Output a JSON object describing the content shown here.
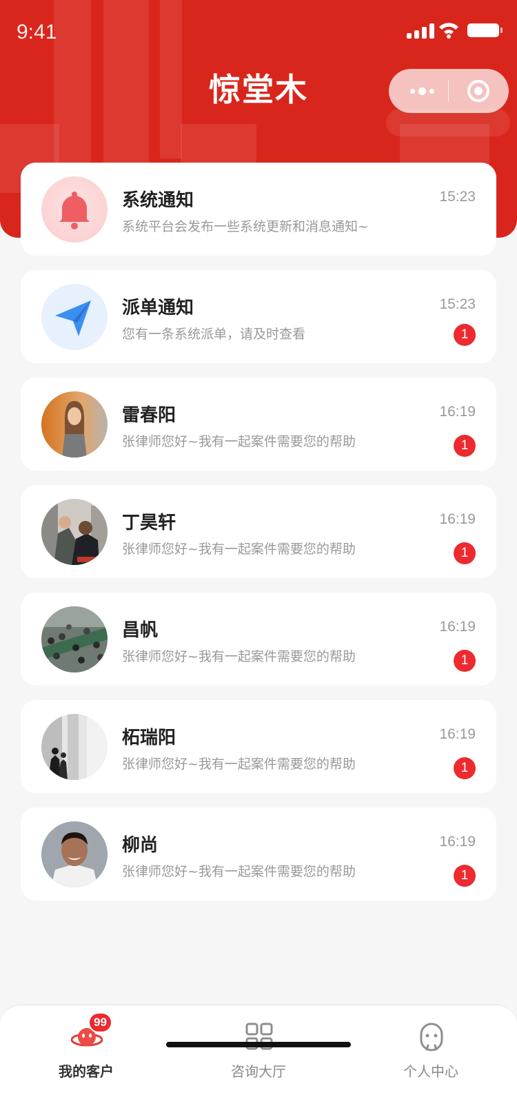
{
  "status_bar": {
    "time": "9:41"
  },
  "header": {
    "app_title": "惊堂木"
  },
  "messages": [
    {
      "title": "系统通知",
      "preview": "系统平台会发布一些系统更新和消息通知~",
      "time": "15:23",
      "avatar": "bell-icon"
    },
    {
      "title": "派单通知",
      "preview": "您有一条系统派单，请及时查看",
      "time": "15:23",
      "badge": "1",
      "avatar": "paper-plane-icon"
    },
    {
      "title": "雷春阳",
      "preview": "张律师您好~我有一起案件需要您的帮助",
      "time": "16:19",
      "badge": "1",
      "avatar": "user-photo"
    },
    {
      "title": "丁昊轩",
      "preview": "张律师您好~我有一起案件需要您的帮助",
      "time": "16:19",
      "badge": "1",
      "avatar": "user-photo"
    },
    {
      "title": "昌帆",
      "preview": "张律师您好~我有一起案件需要您的帮助",
      "time": "16:19",
      "badge": "1",
      "avatar": "user-photo"
    },
    {
      "title": "柘瑞阳",
      "preview": "张律师您好~我有一起案件需要您的帮助",
      "time": "16:19",
      "badge": "1",
      "avatar": "user-photo"
    },
    {
      "title": "柳尚",
      "preview": "张律师您好~我有一起案件需要您的帮助",
      "time": "16:19",
      "badge": "1",
      "avatar": "user-photo"
    }
  ],
  "tab_bar": {
    "tabs": [
      {
        "label": "我的客户",
        "icon": "customers-icon",
        "badge": "99",
        "active": true
      },
      {
        "label": "咨询大厅",
        "icon": "grid-icon",
        "active": false
      },
      {
        "label": "个人中心",
        "icon": "user-face-icon",
        "active": false
      }
    ]
  },
  "colors": {
    "brand_red": "#d9261c",
    "badge_red": "#ec2a2f",
    "background": "#f6f6f6"
  }
}
